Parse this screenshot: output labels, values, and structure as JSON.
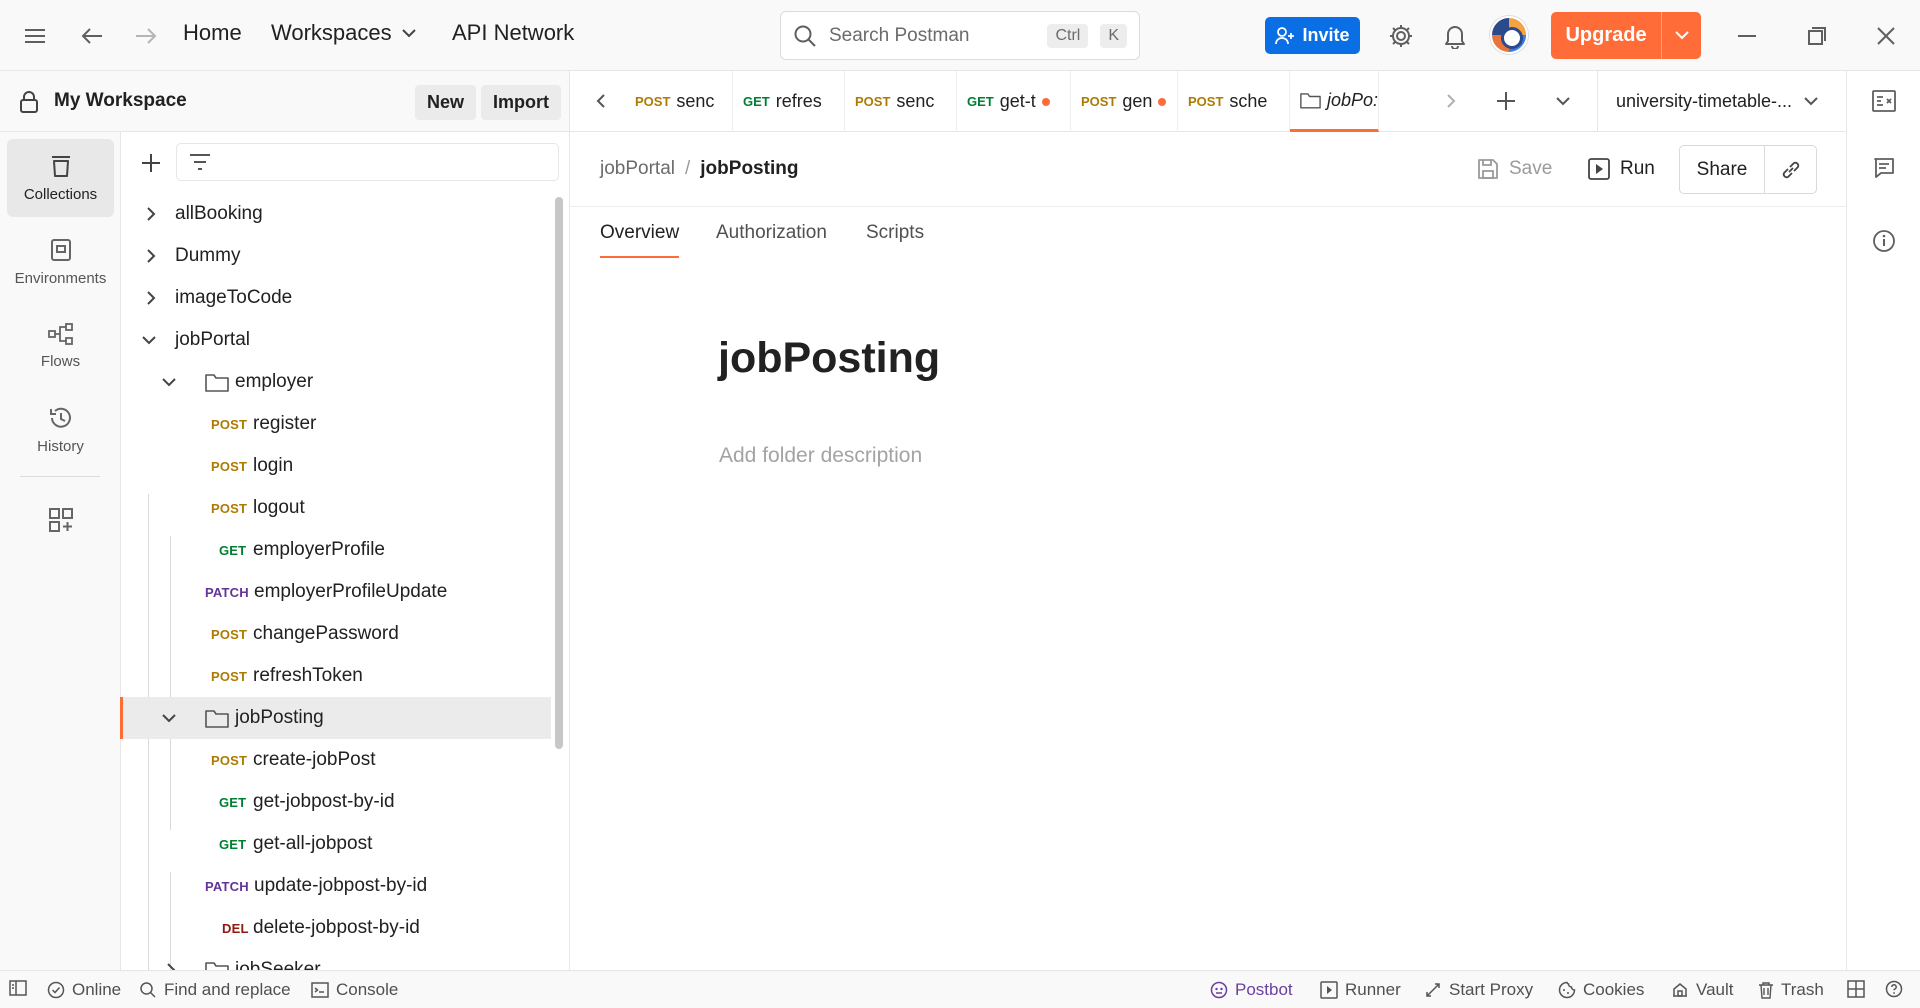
{
  "header": {
    "home": "Home",
    "workspaces": "Workspaces",
    "api_network": "API Network",
    "search_placeholder": "Search Postman",
    "shortcut_ctrl": "Ctrl",
    "shortcut_key": "K",
    "invite": "Invite",
    "upgrade": "Upgrade"
  },
  "workspace": {
    "title": "My Workspace",
    "new_label": "New",
    "import_label": "Import"
  },
  "leftnav": {
    "items": [
      {
        "label": "Collections",
        "icon": "collections-icon"
      },
      {
        "label": "Environments",
        "icon": "environments-icon"
      },
      {
        "label": "Flows",
        "icon": "flows-icon"
      },
      {
        "label": "History",
        "icon": "history-icon"
      }
    ]
  },
  "tree": {
    "collections": [
      {
        "name": "allBooking",
        "expanded": false
      },
      {
        "name": "Dummy",
        "expanded": false
      },
      {
        "name": "imageToCode",
        "expanded": false
      },
      {
        "name": "jobPortal",
        "expanded": true
      }
    ],
    "employer_folder": "employer",
    "employer_requests": [
      {
        "method": "POST",
        "name": "register"
      },
      {
        "method": "POST",
        "name": "login"
      },
      {
        "method": "POST",
        "name": "logout"
      },
      {
        "method": "GET",
        "name": "employerProfile"
      },
      {
        "method": "PATCH",
        "name": "employerProfileUpdate"
      },
      {
        "method": "POST",
        "name": "changePassword"
      },
      {
        "method": "POST",
        "name": "refreshToken"
      }
    ],
    "jobposting_folder": "jobPosting",
    "jobposting_requests": [
      {
        "method": "POST",
        "name": "create-jobPost"
      },
      {
        "method": "GET",
        "name": "get-jobpost-by-id"
      },
      {
        "method": "GET",
        "name": "get-all-jobpost"
      },
      {
        "method": "PATCH",
        "name": "update-jobpost-by-id"
      },
      {
        "method": "DEL",
        "name": "delete-jobpost-by-id"
      }
    ],
    "jobseeker_folder": "jobSeeker"
  },
  "tabs": [
    {
      "method": "POST",
      "name": "senc",
      "unsaved": false
    },
    {
      "method": "GET",
      "name": "refres",
      "unsaved": false
    },
    {
      "method": "POST",
      "name": "senc",
      "unsaved": false
    },
    {
      "method": "GET",
      "name": "get-t",
      "unsaved": true
    },
    {
      "method": "POST",
      "name": "gen",
      "unsaved": true
    },
    {
      "method": "POST",
      "name": "sche",
      "unsaved": false
    },
    {
      "method": "",
      "name": "jobPo:",
      "unsaved": false,
      "active": true
    }
  ],
  "environment": "university-timetable-...",
  "main": {
    "breadcrumb_parent": "jobPortal",
    "breadcrumb_sep": "/",
    "breadcrumb_current": "jobPosting",
    "save": "Save",
    "run": "Run",
    "share": "Share",
    "subtabs": [
      "Overview",
      "Authorization",
      "Scripts"
    ],
    "folder_title": "jobPosting",
    "description_placeholder": "Add folder description"
  },
  "statusbar": {
    "online": "Online",
    "find_replace": "Find and replace",
    "console": "Console",
    "postbot": "Postbot",
    "runner": "Runner",
    "start_proxy": "Start Proxy",
    "cookies": "Cookies",
    "vault": "Vault",
    "trash": "Trash"
  },
  "colors": {
    "accent": "#ff6c37",
    "invite_blue": "#0a6fe4",
    "post": "#ad7a03",
    "get": "#007f31",
    "patch": "#623497",
    "delete": "#8e1a10"
  }
}
